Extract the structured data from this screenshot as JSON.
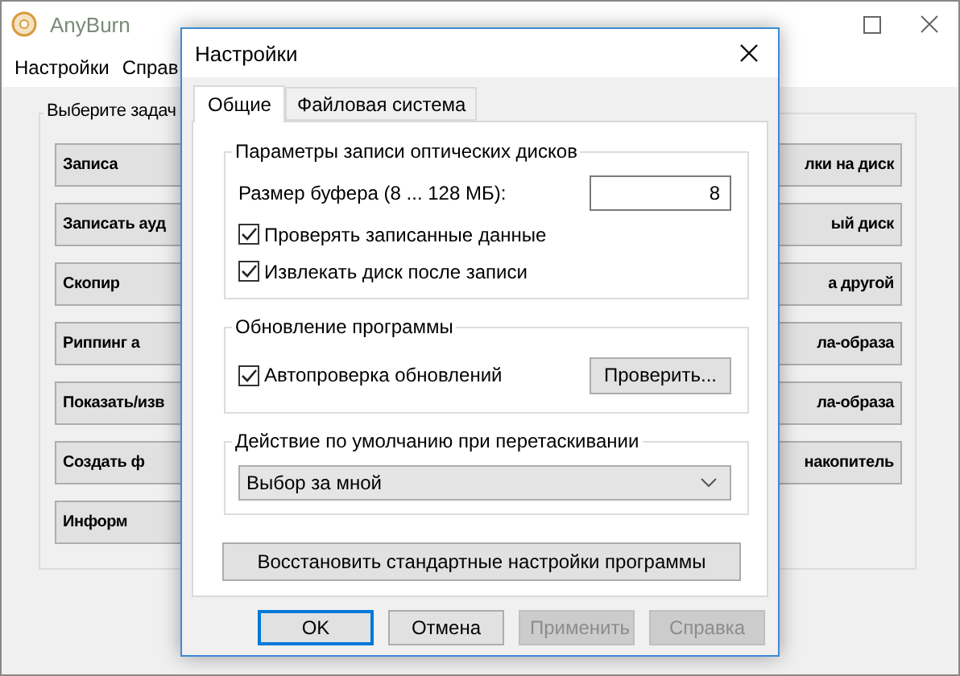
{
  "main_window": {
    "title": "AnyBurn",
    "menu": [
      "Настройки",
      "Справ"
    ],
    "group_label": "Выберите задач",
    "tasks_left": [
      "Записа",
      "Записать ауд",
      "Скопир",
      "Риппинг а",
      "Показать/изв",
      "Создать ф",
      "Информ"
    ],
    "tasks_right": [
      "лки на диск",
      "ый диск",
      "а другой",
      "ла-образа",
      "ла-образа",
      "накопитель"
    ]
  },
  "dialog": {
    "title": "Настройки",
    "tabs": [
      {
        "label": "Общие",
        "selected": true
      },
      {
        "label": "Файловая система",
        "selected": false
      }
    ],
    "groups": [
      {
        "title": "Параметры записи оптических дисков",
        "rows": [
          {
            "kind": "number",
            "label": "Размер буфера (8 ... 128 МБ):",
            "value": "8"
          },
          {
            "kind": "checkbox",
            "label": "Проверять записанные данные",
            "checked": true
          },
          {
            "kind": "checkbox",
            "label": "Извлекать диск после записи",
            "checked": true
          }
        ]
      },
      {
        "title": "Обновление программы",
        "rows": [
          {
            "kind": "checkbox",
            "label": "Автопроверка обновлений",
            "checked": true,
            "button": "Проверить..."
          }
        ]
      },
      {
        "title": "Действие по умолчанию при перетаскивании",
        "rows": [
          {
            "kind": "select",
            "value": "Выбор за мной"
          }
        ]
      }
    ],
    "restore_button": "Восстановить стандартные настройки программы",
    "buttons": [
      {
        "label": "OK",
        "default": true,
        "disabled": false
      },
      {
        "label": "Отмена",
        "default": false,
        "disabled": false
      },
      {
        "label": "Применить",
        "default": false,
        "disabled": true
      },
      {
        "label": "Справка",
        "default": false,
        "disabled": true
      }
    ]
  }
}
